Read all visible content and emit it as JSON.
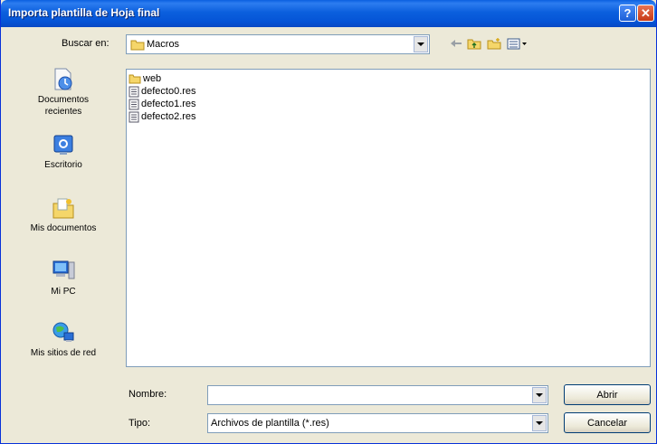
{
  "window": {
    "title": "Importa plantilla de Hoja final",
    "help_glyph": "?",
    "close_glyph": "✕"
  },
  "lookin": {
    "label": "Buscar en:",
    "value": "Macros"
  },
  "places": [
    {
      "label_line1": "Documentos",
      "label_line2": "recientes",
      "icon": "recent-documents-icon"
    },
    {
      "label_line1": "Escritorio",
      "label_line2": "",
      "icon": "desktop-icon"
    },
    {
      "label_line1": "Mis documentos",
      "label_line2": "",
      "icon": "my-documents-icon"
    },
    {
      "label_line1": "Mi PC",
      "label_line2": "",
      "icon": "my-computer-icon"
    },
    {
      "label_line1": "Mis sitios de red",
      "label_line2": "",
      "icon": "network-places-icon"
    }
  ],
  "files": [
    {
      "name": "web",
      "type": "folder"
    },
    {
      "name": "defecto0.res",
      "type": "file"
    },
    {
      "name": "defecto1.res",
      "type": "file"
    },
    {
      "name": "defecto2.res",
      "type": "file"
    }
  ],
  "filename": {
    "label": "Nombre:",
    "value": ""
  },
  "filetype": {
    "label": "Tipo:",
    "value": "Archivos de plantilla (*.res)"
  },
  "buttons": {
    "open": "Abrir",
    "cancel": "Cancelar"
  },
  "colors": {
    "titlebar": "#0554d6",
    "window_bg": "#ece9d8",
    "field_border": "#7f9db9"
  }
}
